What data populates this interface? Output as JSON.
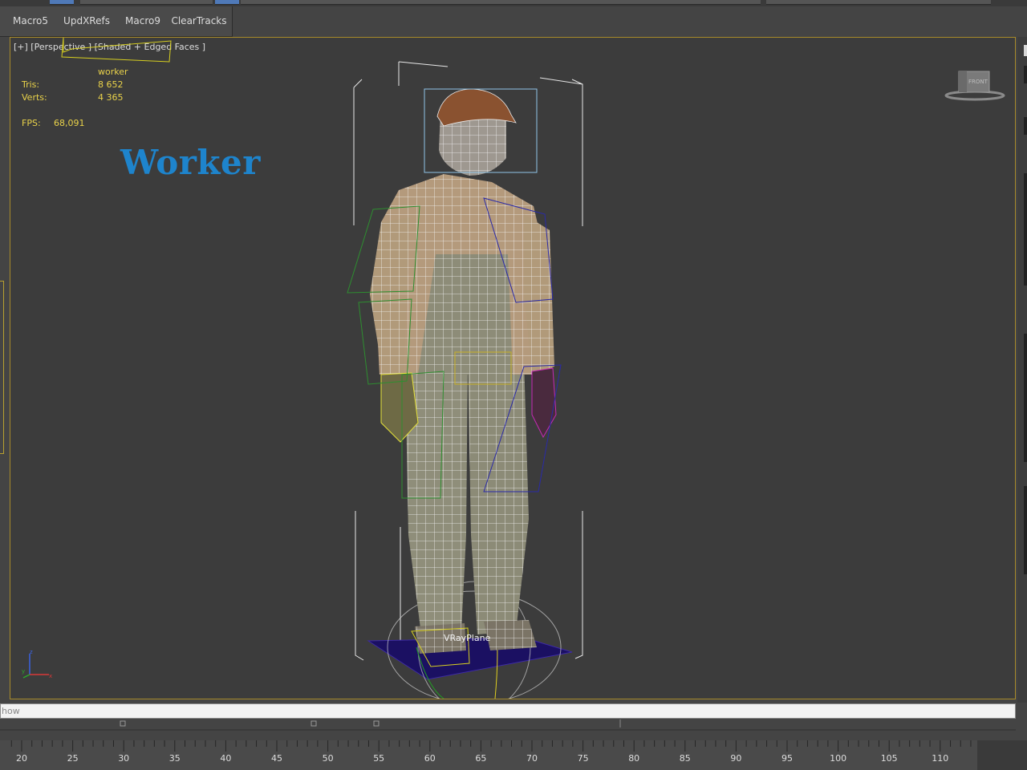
{
  "toolbar": {
    "buttons": [
      {
        "label": "Macro5"
      },
      {
        "label": "UpdXRefs"
      },
      {
        "label": "Macro9"
      },
      {
        "label": "ClearTracks"
      }
    ]
  },
  "viewport": {
    "label": "[+] [Perspective ] [Shaded + Edged Faces ]",
    "object_name": "worker",
    "tris_label": "Tris:",
    "tris_value": "8 652",
    "verts_label": "Verts:",
    "verts_value": "4 365",
    "fps_label": "FPS:",
    "fps_value": "68,091",
    "overlay_title": "Worker",
    "plane_label": "VRayPlane",
    "viewcube_label": "FRONT",
    "colors": {
      "border": "#a78a2a",
      "stats_text": "#e9d24a",
      "title_blue": "#1e84cc"
    }
  },
  "icons": {
    "viewcube": "viewcube-icon",
    "axis": "axis-tripod-icon"
  },
  "command_bar": {
    "text": "how"
  },
  "timeline": {
    "ticks": [
      "20",
      "25",
      "30",
      "35",
      "40",
      "45",
      "50",
      "55",
      "60",
      "65",
      "70",
      "75",
      "80",
      "85",
      "90",
      "95",
      "100",
      "105",
      "110"
    ]
  }
}
